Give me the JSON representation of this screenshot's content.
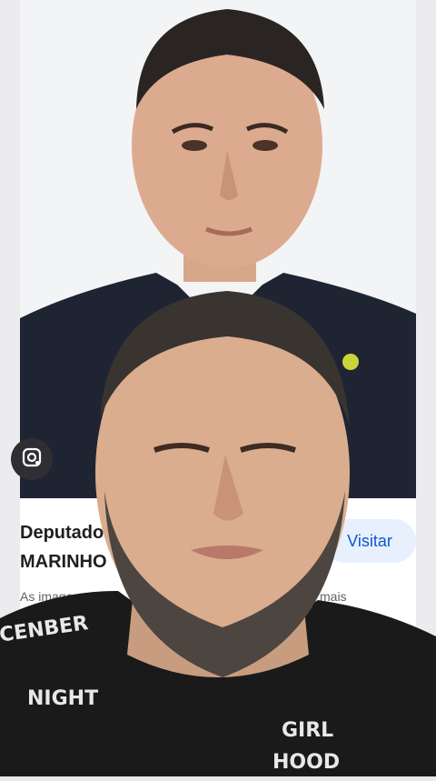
{
  "result": {
    "title_line1": "Deputado",
    "title_line2": "MARINHO",
    "visit_label": "Visitar",
    "caption": "As imagens",
    "caption_more": "mais"
  },
  "icons": {
    "lens": "google-lens-icon"
  },
  "shirt_prints": [
    "CENBER",
    "NIGHT",
    "GIRL",
    "HOOD"
  ],
  "colors": {
    "accent": "#0b57d0",
    "visit_bg": "#e8f0fe",
    "suit": "#1f2433",
    "shirt": "#1a1a1a"
  }
}
